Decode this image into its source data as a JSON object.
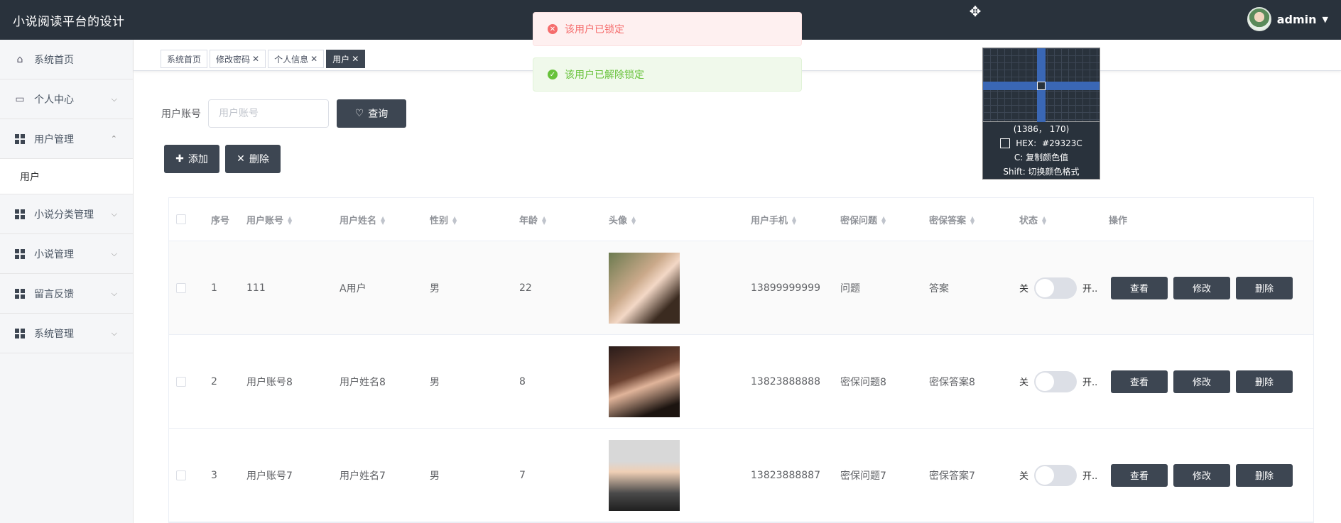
{
  "header": {
    "title": "小说阅读平台的设计",
    "user_name": "admin"
  },
  "sidebar": {
    "items": [
      {
        "label": "系统首页"
      },
      {
        "label": "个人中心"
      },
      {
        "label": "用户管理"
      },
      {
        "label": "小说分类管理"
      },
      {
        "label": "小说管理"
      },
      {
        "label": "留言反馈"
      },
      {
        "label": "系统管理"
      }
    ],
    "sub_item": "用户"
  },
  "tabs": [
    {
      "label": "系统首页"
    },
    {
      "label": "修改密码"
    },
    {
      "label": "个人信息"
    },
    {
      "label": "用户"
    }
  ],
  "search": {
    "label": "用户账号",
    "placeholder": "用户账号",
    "button": "查询"
  },
  "actions": {
    "add": "添加",
    "delete": "删除"
  },
  "table": {
    "headers": [
      "序号",
      "用户账号",
      "用户姓名",
      "性别",
      "年龄",
      "头像",
      "用户手机",
      "密保问题",
      "密保答案",
      "状态",
      "操作"
    ],
    "rows": [
      {
        "index": "1",
        "account": "111",
        "name": "A用户",
        "gender": "男",
        "age": "22",
        "phone": "13899999999",
        "question": "问题",
        "answer": "答案"
      },
      {
        "index": "2",
        "account": "用户账号8",
        "name": "用户姓名8",
        "gender": "男",
        "age": "8",
        "phone": "13823888888",
        "question": "密保问题8",
        "answer": "密保答案8"
      },
      {
        "index": "3",
        "account": "用户账号7",
        "name": "用户姓名7",
        "gender": "男",
        "age": "7",
        "phone": "13823888887",
        "question": "密保问题7",
        "answer": "密保答案7"
      }
    ],
    "switch_off": "关",
    "switch_on": "开..",
    "ops": {
      "view": "查看",
      "edit": "修改",
      "delete": "删除"
    }
  },
  "toasts": {
    "error": "该用户已锁定",
    "success": "该用户已解除锁定"
  },
  "color_picker": {
    "coords": "(1386， 170)",
    "hex_label": "HEX:",
    "hex_value": "#29323C",
    "copy_hint": "C: 复制颜色值",
    "shift_hint": "Shift: 切换颜色格式"
  },
  "colors": {
    "header_bg": "#29323c",
    "button_dark": "#3d4652",
    "error": "#f56c6c",
    "success": "#67c23a"
  }
}
